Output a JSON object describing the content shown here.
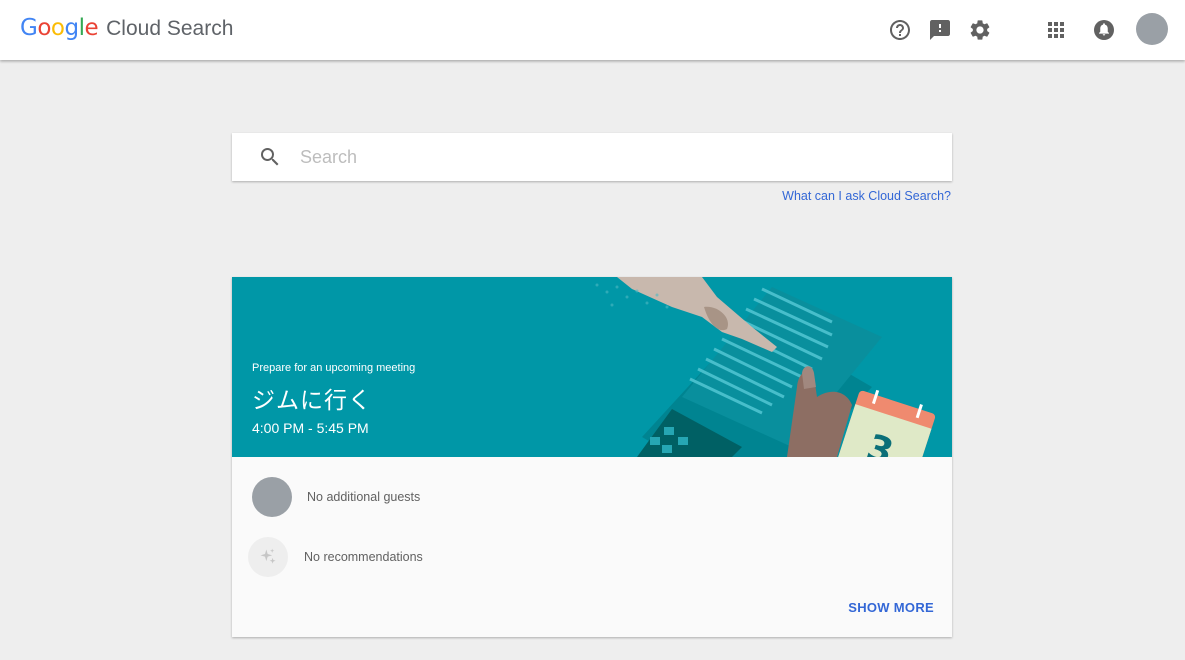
{
  "header": {
    "logo_letters": [
      {
        "ch": "G",
        "color": "#4285F4"
      },
      {
        "ch": "o",
        "color": "#EA4335"
      },
      {
        "ch": "o",
        "color": "#FBBC05"
      },
      {
        "ch": "g",
        "color": "#4285F4"
      },
      {
        "ch": "l",
        "color": "#34A853"
      },
      {
        "ch": "e",
        "color": "#EA4335"
      }
    ],
    "product_name": "Cloud Search",
    "icons": [
      "help-icon",
      "feedback-icon",
      "settings-icon",
      "apps-icon",
      "notifications-icon",
      "account-avatar"
    ]
  },
  "search": {
    "placeholder": "Search",
    "value": "",
    "help_link": "What can I ask Cloud Search?"
  },
  "meeting_card": {
    "kicker": "Prepare for an upcoming meeting",
    "title": "ジムに行く",
    "time": "4:00 PM - 5:45 PM",
    "guests_text": "No additional guests",
    "recommendations_text": "No recommendations",
    "show_more_label": "SHOW MORE",
    "banner_color": "#0097a7"
  },
  "colors": {
    "accent": "#3367d6",
    "page_background": "#eeeeee",
    "banner": "#0097a7"
  }
}
